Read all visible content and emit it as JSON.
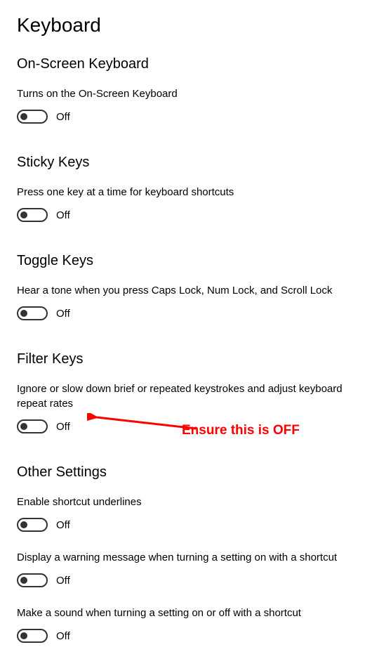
{
  "page_title": "Keyboard",
  "sections": {
    "osk": {
      "heading": "On-Screen Keyboard",
      "desc": "Turns on the On-Screen Keyboard",
      "toggle_state": "Off"
    },
    "sticky": {
      "heading": "Sticky Keys",
      "desc": "Press one key at a time for keyboard shortcuts",
      "toggle_state": "Off"
    },
    "toggle_keys": {
      "heading": "Toggle Keys",
      "desc": "Hear a tone when you press Caps Lock, Num Lock, and Scroll Lock",
      "toggle_state": "Off"
    },
    "filter": {
      "heading": "Filter Keys",
      "desc": "Ignore or slow down brief or repeated keystrokes and adjust keyboard repeat rates",
      "toggle_state": "Off"
    },
    "other": {
      "heading": "Other Settings",
      "items": [
        {
          "desc": "Enable shortcut underlines",
          "toggle_state": "Off"
        },
        {
          "desc": "Display a warning message when turning a setting on with a shortcut",
          "toggle_state": "Off"
        },
        {
          "desc": "Make a sound when turning a setting on or off with a shortcut",
          "toggle_state": "Off"
        }
      ]
    }
  },
  "annotation": {
    "text": "Ensure this is OFF",
    "color": "#ff0000"
  }
}
